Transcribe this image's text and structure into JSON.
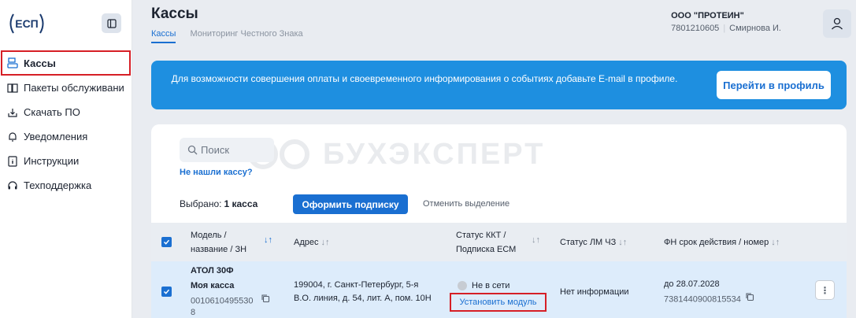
{
  "logo": {
    "text": "ЕСП"
  },
  "sidebar": {
    "items": [
      {
        "label": "Кассы",
        "icon": "cash-register-icon",
        "active": true
      },
      {
        "label": "Пакеты обслуживани",
        "icon": "book-icon"
      },
      {
        "label": "Скачать ПО",
        "icon": "download-icon"
      },
      {
        "label": "Уведомления",
        "icon": "bell-icon"
      },
      {
        "label": "Инструкции",
        "icon": "info-icon"
      },
      {
        "label": "Техподдержка",
        "icon": "headset-icon"
      }
    ]
  },
  "header": {
    "title": "Кассы",
    "tabs": [
      {
        "label": "Кассы",
        "active": true
      },
      {
        "label": "Мониторинг Честного Знака"
      }
    ],
    "org": {
      "name": "ООО \"ПРОТЕИН\"",
      "inn": "7801210605",
      "user": "Смирнова И."
    }
  },
  "banner": {
    "text": "Для возможности совершения оплаты и своевременного информирования о событиях добавьте E-mail в профиле.",
    "button": "Перейти в профиль"
  },
  "toolbar": {
    "search_placeholder": "Поиск",
    "not_found_link": "Не нашли кассу?",
    "selected_label": "Выбрано:",
    "selected_count": "1 касса",
    "subscribe_button": "Оформить подписку",
    "cancel_selection": "Отменить выделение"
  },
  "watermark": {
    "text": "БУХЭКСПЕРТ"
  },
  "table": {
    "columns": [
      {
        "line1": "Модель /",
        "line2": "название / ЗН"
      },
      {
        "line1": "Адрес",
        "line2": ""
      },
      {
        "line1": "Статус ККТ /",
        "line2": "Подписка ЕСМ"
      },
      {
        "line1": "Статус ЛМ ЧЗ",
        "line2": ""
      },
      {
        "line1": "ФН срок действия / номер",
        "line2": ""
      }
    ],
    "rows": [
      {
        "model": "АТОЛ 30Ф",
        "name": "Моя касса",
        "serial": "0010610495530",
        "serial_tail": "8",
        "address_line1": "199004, г. Санкт-Петербург, 5-я",
        "address_line2": "В.О. линия, д. 54, лит. А, пом. 10Н",
        "kkt_status": "Не в сети",
        "install_link": "Установить модуль",
        "lm_status": "Нет информации",
        "fn_date": "до 28.07.2028",
        "fn_number": "7381440900815534",
        "kebab": "⋮"
      }
    ]
  },
  "colors": {
    "accent": "#1a6fd1",
    "banner": "#1e8fe0",
    "highlight": "#d61f26"
  }
}
